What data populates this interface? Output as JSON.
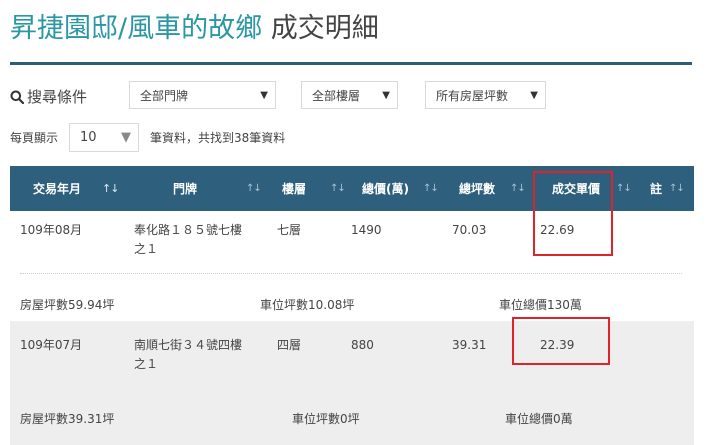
{
  "title": {
    "name": "昇捷園邸/風車的故鄉",
    "suffix": "成交明細"
  },
  "filters": {
    "search_label": "搜尋條件",
    "door_select": "全部門牌",
    "floor_select": "全部樓層",
    "ping_select": "所有房屋坪數"
  },
  "paging": {
    "per_page_label": "每頁顯示",
    "per_page_value": "10",
    "result_text": "筆資料，共找到38筆資料"
  },
  "table": {
    "headers": [
      "交易年月",
      "門牌",
      "樓層",
      "總價(萬)",
      "總坪數",
      "成交單價",
      "註"
    ],
    "rows": [
      {
        "date": "109年08月",
        "address_line1": "奉化路１８５號七樓",
        "address_line2": "之１",
        "floor": "七層",
        "total_price": "1490",
        "total_ping": "70.03",
        "unit_price": "22.69",
        "house_ping": "房屋坪數59.94坪",
        "parking_ping": "車位坪數10.08坪",
        "parking_price": "車位總價130萬"
      },
      {
        "date": "109年07月",
        "address_line1": "南順七街３４號四樓",
        "address_line2": "之１",
        "floor": "四層",
        "total_price": "880",
        "total_ping": "39.31",
        "unit_price": "22.39",
        "house_ping": "房屋坪數39.31坪",
        "parking_ping": "車位坪數0坪",
        "parking_price": "車位總價0萬"
      }
    ]
  },
  "colors": {
    "title_accent": "#2b97a3",
    "header_bg": "#2e5f7c",
    "highlight": "#e0222b",
    "alt_row": "#eeeeee"
  },
  "icons": {
    "search": "magnifier-icon",
    "sort": "sort-arrows-icon",
    "dropdown": "caret-down-icon"
  }
}
